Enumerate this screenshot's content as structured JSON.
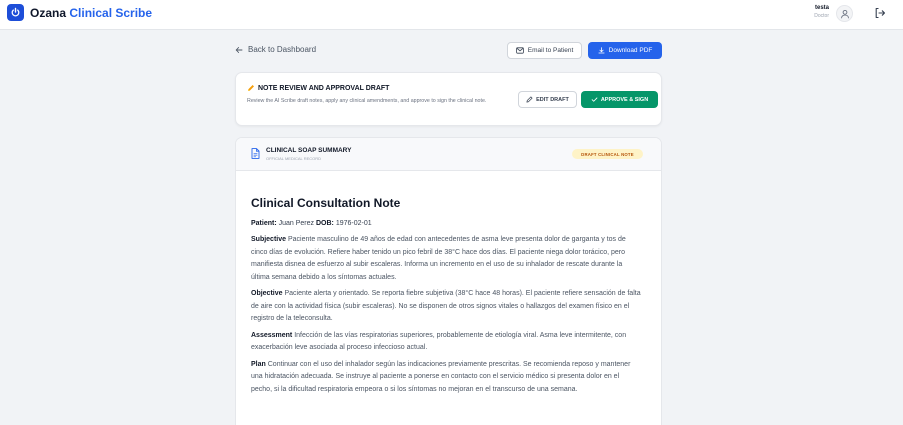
{
  "app": {
    "brand_main": "Ozana",
    "brand_accent": "Clinical Scribe",
    "user_name": "testa",
    "user_role": "Doctor"
  },
  "nav": {
    "back_label": "Back to Dashboard",
    "email_label": "Email to Patient",
    "pdf_label": "Download PDF"
  },
  "review": {
    "title": "NOTE REVIEW AND APPROVAL DRAFT",
    "description": "Review the AI Scribe draft notes, apply any clinical amendments, and approve to sign the clinical note.",
    "edit_label": "EDIT DRAFT",
    "approve_label": "APPROVE & SIGN"
  },
  "summary": {
    "title": "CLINICAL SOAP SUMMARY",
    "subtitle": "OFFICIAL MEDICAL RECORD",
    "badge": "DRAFT CLINICAL NOTE"
  },
  "note": {
    "title": "Clinical Consultation Note",
    "patient_label": "Patient:",
    "patient_value": "Juan Perez",
    "dob_label": "DOB:",
    "dob_value": "1976-02-01",
    "subjective_label": "Subjective",
    "subjective_text": "Paciente masculino de 49 años de edad con antecedentes de asma leve presenta dolor de garganta y tos de cinco días de evolución. Refiere haber tenido un pico febril de 38°C hace dos días. El paciente niega dolor torácico, pero manifiesta disnea de esfuerzo al subir escaleras. Informa un incremento en el uso de su inhalador de rescate durante la última semana debido a los síntomas actuales.",
    "objective_label": "Objective",
    "objective_text": "Paciente alerta y orientado. Se reporta fiebre subjetiva (38°C hace 48 horas). El paciente refiere sensación de falta de aire con la actividad física (subir escaleras). No se disponen de otros signos vitales o hallazgos del examen físico en el registro de la teleconsulta.",
    "assessment_label": "Assessment",
    "assessment_text": "Infección de las vías respiratorias superiores, probablemente de etiología viral. Asma leve intermitente, con exacerbación leve asociada al proceso infeccioso actual.",
    "plan_label": "Plan",
    "plan_text": "Continuar con el uso del inhalador según las indicaciones previamente prescritas. Se recomienda reposo y mantener una hidratación adecuada. Se instruye al paciente a ponerse en contacto con el servicio médico si presenta dolor en el pecho, si la dificultad respiratoria empeora o si los síntomas no mejoran en el transcurso de una semana."
  },
  "colors": {
    "primary": "#2563eb",
    "success": "#059669",
    "badge_bg": "#fef3c7",
    "badge_text": "#b45309"
  },
  "icons": [
    "power-icon",
    "user-icon",
    "logout-icon",
    "arrow-left-icon",
    "mail-icon",
    "download-icon",
    "pencil-icon",
    "edit-icon",
    "check-icon",
    "document-icon"
  ]
}
